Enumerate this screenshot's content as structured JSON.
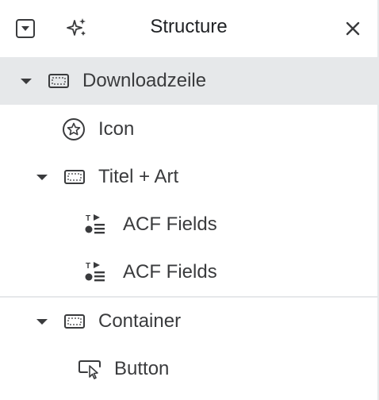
{
  "header": {
    "title": "Structure",
    "left_icon_1": "dropdown-toggle-icon",
    "left_icon_2": "ai-sparkle-icon",
    "close_icon": "close-icon"
  },
  "tree": [
    {
      "label": "Downloadzeile",
      "icon": "container-icon",
      "expanded": true,
      "selected": true
    },
    {
      "label": "Icon",
      "icon": "star-icon"
    },
    {
      "label": "Titel + Art",
      "icon": "container-icon",
      "expanded": true
    },
    {
      "label": "ACF Fields",
      "icon": "acf-fields-icon"
    },
    {
      "label": "ACF Fields",
      "icon": "acf-fields-icon"
    },
    {
      "label": "Container",
      "icon": "container-icon",
      "expanded": true
    },
    {
      "label": "Button",
      "icon": "button-icon"
    }
  ],
  "colors": {
    "selected_bg": "#e6e8ea",
    "text": "#3a3b3d"
  }
}
